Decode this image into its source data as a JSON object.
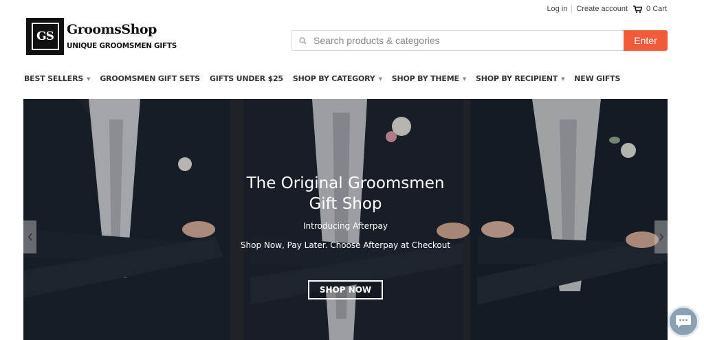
{
  "header": {
    "login_label": "Log in",
    "create_account_label": "Create account",
    "cart_label": "0 Cart"
  },
  "logo": {
    "mark": "GS",
    "name": "GroomsShop",
    "tagline": "UNIQUE GROOMSMEN GIFTS"
  },
  "search": {
    "placeholder": "Search products & categories",
    "button_label": "Enter"
  },
  "nav": {
    "items": [
      {
        "label": "BEST SELLERS",
        "has_dropdown": true
      },
      {
        "label": "GROOMSMEN GIFT SETS",
        "has_dropdown": false
      },
      {
        "label": "GIFTS UNDER $25",
        "has_dropdown": false
      },
      {
        "label": "SHOP BY CATEGORY",
        "has_dropdown": true
      },
      {
        "label": "SHOP BY THEME",
        "has_dropdown": true
      },
      {
        "label": "SHOP BY RECIPIENT",
        "has_dropdown": true
      },
      {
        "label": "NEW GIFTS",
        "has_dropdown": false
      }
    ]
  },
  "hero": {
    "title_line1": "The Original Groomsmen",
    "title_line2": "Gift Shop",
    "subtitle": "Introducing Afterpay",
    "text": "Shop Now, Pay Later. Choose Afterpay at Checkout",
    "cta_label": "SHOP NOW"
  },
  "colors": {
    "accent": "#f15a3a",
    "text": "#333333"
  }
}
